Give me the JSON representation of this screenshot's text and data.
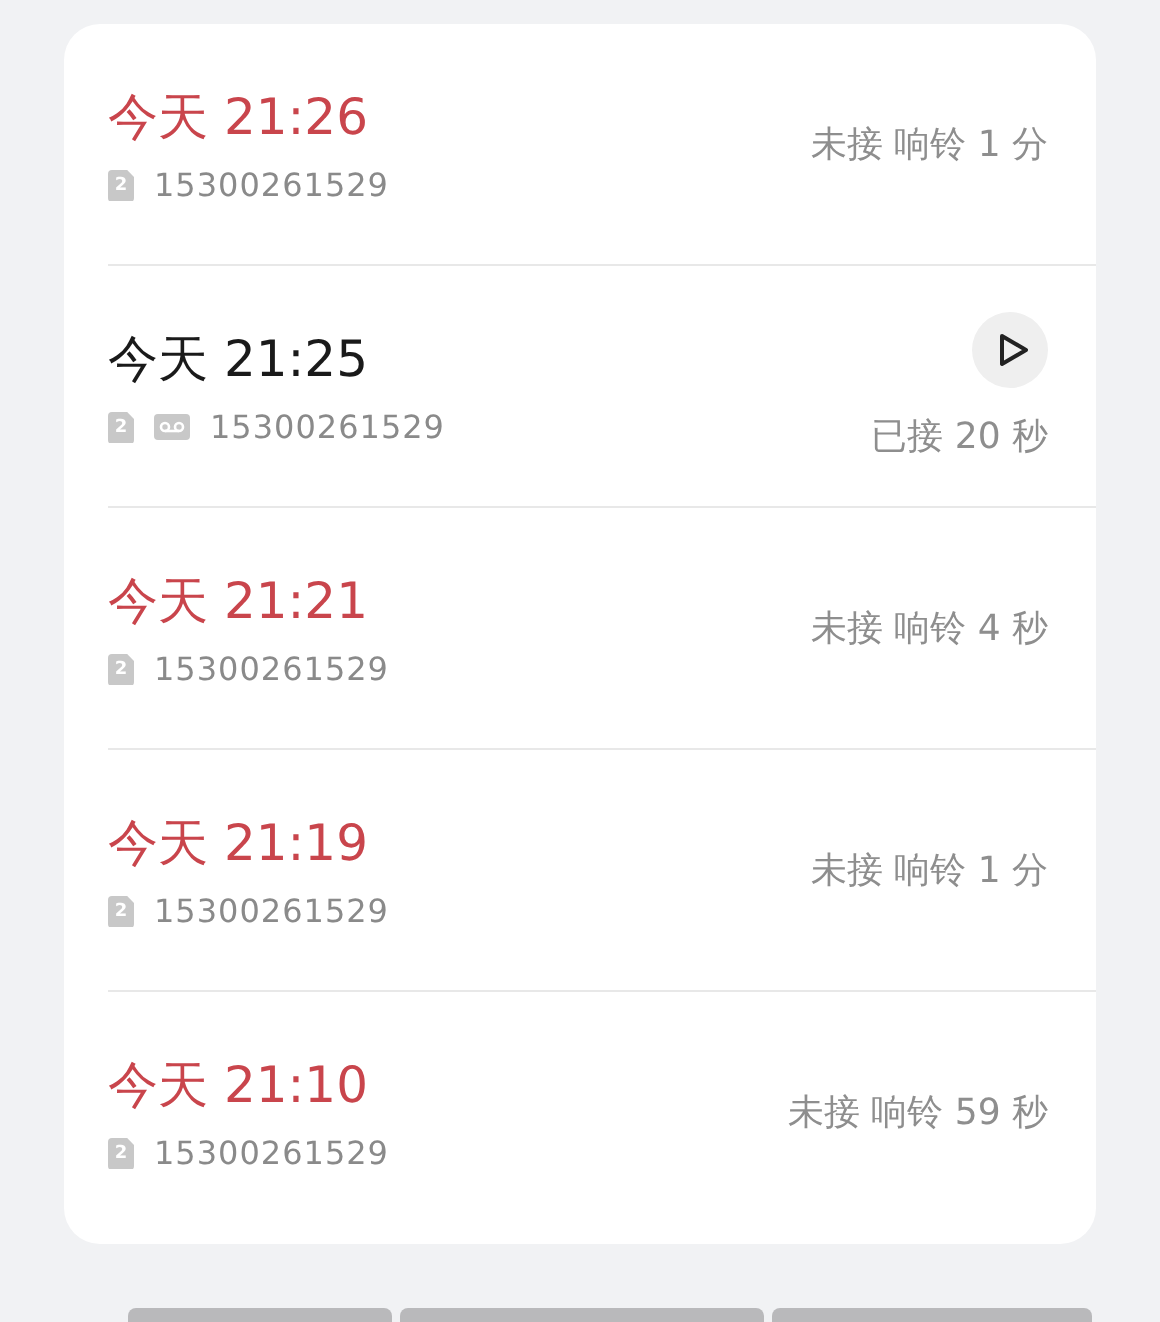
{
  "calls": [
    {
      "time": "今天 21:26",
      "missed": true,
      "sim": "2",
      "voicemail": false,
      "number": "15300261529",
      "status": "未接 响铃 1 分",
      "playable": false
    },
    {
      "time": "今天 21:25",
      "missed": false,
      "sim": "2",
      "voicemail": true,
      "number": "15300261529",
      "status": "已接 20 秒",
      "playable": true
    },
    {
      "time": "今天 21:21",
      "missed": true,
      "sim": "2",
      "voicemail": false,
      "number": "15300261529",
      "status": "未接 响铃 4 秒",
      "playable": false
    },
    {
      "time": "今天 21:19",
      "missed": true,
      "sim": "2",
      "voicemail": false,
      "number": "15300261529",
      "status": "未接 响铃 1 分",
      "playable": false
    },
    {
      "time": "今天 21:10",
      "missed": true,
      "sim": "2",
      "voicemail": false,
      "number": "15300261529",
      "status": "未接 响铃 59 秒",
      "playable": false
    }
  ]
}
